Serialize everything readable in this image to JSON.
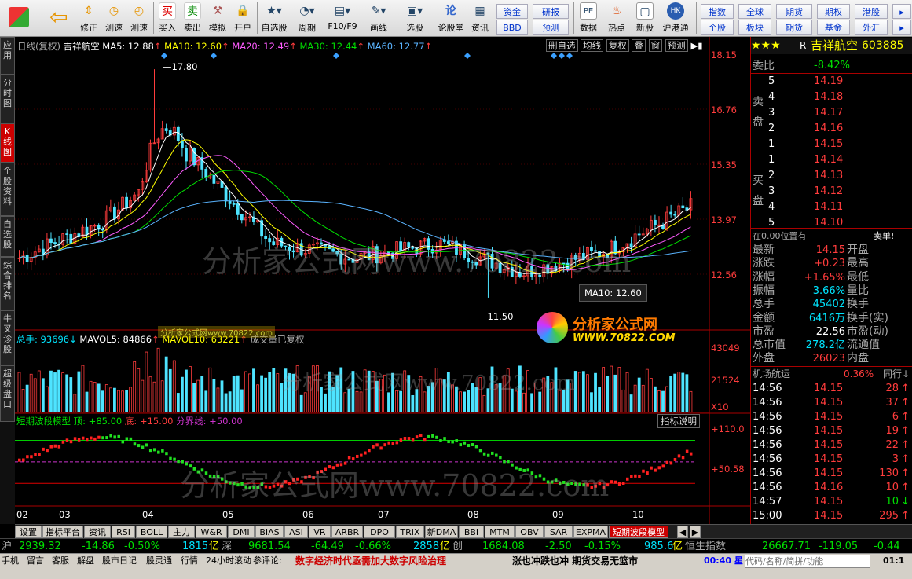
{
  "toolbar": {
    "buttons": [
      {
        "label": "",
        "icon": "windows-icon"
      },
      {
        "label": "",
        "icon": "back-arrow-icon"
      },
      {
        "label": "修正",
        "icon": "updown-icon"
      },
      {
        "label": "测速",
        "icon": "clock-icon"
      },
      {
        "label": "买入",
        "icon": "buy-icon"
      },
      {
        "label": "卖出",
        "icon": "sell-icon"
      },
      {
        "label": "模拟",
        "icon": "hammer-icon"
      },
      {
        "label": "开户",
        "icon": "lock-icon"
      },
      {
        "label": "自选股",
        "icon": "star-icon"
      },
      {
        "label": "周期",
        "icon": "cycle-icon"
      },
      {
        "label": "F10/F9",
        "icon": "f10-icon"
      },
      {
        "label": "画线",
        "icon": "pen-icon"
      },
      {
        "label": "选股",
        "icon": "select-stock-icon"
      },
      {
        "label": "论股堂",
        "icon": "forum-icon"
      },
      {
        "label": "资讯",
        "icon": "news-icon"
      },
      {
        "label": "数据",
        "icon": "data-icon"
      },
      {
        "label": "热点",
        "icon": "hot-icon"
      },
      {
        "label": "新股",
        "icon": "new-stock-icon"
      },
      {
        "label": "沪港通",
        "icon": "hk-connect-icon"
      }
    ],
    "mid_top": [
      "资金",
      "研报"
    ],
    "mid_bot": [
      "BBD",
      "预测"
    ],
    "right_top": [
      "指数",
      "全球",
      "期货",
      "期权",
      "港股"
    ],
    "right_bot": [
      "个股",
      "板块",
      "期货",
      "基金",
      "外汇"
    ]
  },
  "sidetabs": [
    "应用",
    "分时图",
    "K线图",
    "个股资料",
    "自选股",
    "综合排名",
    "牛叉诊股",
    "超级盘口"
  ],
  "chart": {
    "title_line": {
      "period": "日线(复权)",
      "name": "吉祥航空",
      "ma5": "MA5: 12.88",
      "ma10": "MA10: 12.60",
      "ma20": "MA20: 12.49",
      "ma30": "MA30: 12.44",
      "ma60": "MA60: 12.77"
    },
    "tools": [
      "删自选",
      "均线",
      "复权",
      "叠",
      "窗",
      "预测"
    ],
    "price_axis": [
      "18.15",
      "16.76",
      "15.35",
      "13.97",
      "12.56"
    ],
    "high_label": "17.80",
    "low_label": "11.50",
    "tooltip": "MA10: 12.60",
    "vol_title": {
      "total": "总手: 93696",
      "mavol5": "MAVOL5: 84866",
      "mavol10": "MAVOL10: 63221",
      "note": "成交量已复权"
    },
    "vol_axis": [
      "43049",
      "21524",
      "X10"
    ],
    "ind_title": {
      "name": "短期波段模型",
      "top": "顶: +85.00",
      "bottom": "底: +15.00",
      "line": "分界线: +50.00"
    },
    "ind_btn": "指标说明",
    "ind_axis": [
      "+110.0",
      "+50.58"
    ],
    "months": [
      "02",
      "03",
      "04",
      "05",
      "06",
      "07",
      "08",
      "09",
      "10"
    ],
    "watermark": "分析家公式网www.70822.com",
    "logo_text": "分析家公式网",
    "logo_url": "WWW.70822.COM"
  },
  "chart_data": {
    "type": "candlestick",
    "title": "吉祥航空",
    "ylim": [
      11.0,
      18.3
    ],
    "x": [
      "02",
      "03",
      "04",
      "05",
      "06",
      "07",
      "08",
      "09",
      "10"
    ],
    "close_trend": [
      12.6,
      13.6,
      15.5,
      13.0,
      12.6,
      13.0,
      12.2,
      12.8,
      14.0
    ],
    "high": 17.8,
    "low": 11.5,
    "ma": {
      "MA5": 12.88,
      "MA10": 12.6,
      "MA20": 12.49,
      "MA30": 12.44,
      "MA60": 12.77
    },
    "volume": {
      "total": 93696,
      "MAVOL5": 84866,
      "MAVOL10": 63221
    },
    "indicator": {
      "name": "短期波段模型",
      "top": 85.0,
      "bottom": 15.0,
      "line": 50.0
    }
  },
  "quote": {
    "stars": "★★★",
    "prefix": "R",
    "name": "吉祥航空",
    "code": "603885",
    "weibi_label": "委比",
    "weibi": "-8.42%",
    "sell_label": "卖盘",
    "buy_label": "买盘",
    "sell": [
      {
        "n": "5",
        "p": "14.19"
      },
      {
        "n": "4",
        "p": "14.18"
      },
      {
        "n": "3",
        "p": "14.17"
      },
      {
        "n": "2",
        "p": "14.16"
      },
      {
        "n": "1",
        "p": "14.15"
      }
    ],
    "buy": [
      {
        "n": "1",
        "p": "14.14"
      },
      {
        "n": "2",
        "p": "14.13"
      },
      {
        "n": "3",
        "p": "14.12"
      },
      {
        "n": "4",
        "p": "14.11"
      },
      {
        "n": "5",
        "p": "14.10"
      }
    ],
    "position": "在0.00位置有",
    "position_right": "卖单!",
    "stats": [
      {
        "k": "最新",
        "v": "14.15",
        "k2": "开盘",
        "c": "red"
      },
      {
        "k": "涨跌",
        "v": "+0.23",
        "k2": "最高",
        "c": "red"
      },
      {
        "k": "涨幅",
        "v": "+1.65%",
        "k2": "最低",
        "c": "red"
      },
      {
        "k": "振幅",
        "v": "3.66%",
        "k2": "量比",
        "c": "cyn"
      },
      {
        "k": "总手",
        "v": "45402",
        "k2": "换手",
        "c": "cyn"
      },
      {
        "k": "金额",
        "v": "6416万",
        "k2": "换手(实)",
        "c": "cyn"
      },
      {
        "k": "市盈",
        "v": "22.56",
        "k2": "市盈(动)",
        "c": "wht"
      },
      {
        "k": "总市值",
        "v": "278.2亿",
        "k2": "流通值",
        "c": "cyn"
      },
      {
        "k": "外盘",
        "v": "26023",
        "k2": "内盘",
        "c": "red"
      }
    ],
    "sector": "机场航运",
    "sector_pct": "0.36%",
    "sector_right": "同行↓",
    "trades": [
      {
        "t": "14:56",
        "p": "14.15",
        "v": "28",
        "d": "↑"
      },
      {
        "t": "14:56",
        "p": "14.15",
        "v": "37",
        "d": "↑"
      },
      {
        "t": "14:56",
        "p": "14.15",
        "v": "6",
        "d": "↑"
      },
      {
        "t": "14:56",
        "p": "14.15",
        "v": "19",
        "d": "↑"
      },
      {
        "t": "14:56",
        "p": "14.15",
        "v": "22",
        "d": "↑"
      },
      {
        "t": "14:56",
        "p": "14.15",
        "v": "3",
        "d": "↑"
      },
      {
        "t": "14:56",
        "p": "14.15",
        "v": "130",
        "d": "↑"
      },
      {
        "t": "14:56",
        "p": "14.16",
        "v": "10",
        "d": "↑"
      },
      {
        "t": "14:57",
        "p": "14.15",
        "v": "10",
        "d": "↓"
      },
      {
        "t": "15:00",
        "p": "14.15",
        "v": "295",
        "d": "↑"
      }
    ],
    "tabs": [
      "细",
      "分",
      "筹",
      "焰",
      "指",
      "财"
    ]
  },
  "bottom_tabs": [
    "设置",
    "指标平台",
    "资讯",
    "RSI",
    "BOLL",
    "主力",
    "W&R",
    "DMI",
    "BIAS",
    "ASI",
    "VR",
    "ARBR",
    "DPO",
    "TRIX",
    "新DMA",
    "BBI",
    "MTM",
    "OBV",
    "SAR",
    "EXPMA",
    "短期波段模型"
  ],
  "index_bar": {
    "sh": "沪",
    "sh_val": "2939.32",
    "sh_chg": "-14.86",
    "sh_pct": "-0.50%",
    "sh_amt": "1815",
    "sh_unit": "亿",
    "sz": "深",
    "sz_val": "9681.54",
    "sz_chg": "-64.49",
    "sz_pct": "-0.66%",
    "sz_amt": "2858",
    "sz_unit": "亿",
    "cy": "创",
    "cy_val": "1684.08",
    "cy_chg": "-2.50",
    "cy_pct": "-0.15%",
    "cy_amt": "985.6",
    "cy_unit": "亿",
    "hs": "恒生指数",
    "hs_val": "26667.71",
    "hs_chg": "-119.05",
    "hs_pct": "-0.44"
  },
  "status": {
    "items": [
      "手机",
      "留言",
      "客服",
      "解盘",
      "股市日记",
      "股灵通",
      "行情",
      "24小时滚动"
    ],
    "comment_label": "参评论:",
    "comment": "数字经济时代亟需加大数字风险治理",
    "ticker": "涨也冲跌也冲 期货交易无篮市",
    "time": "00:40 星",
    "search_placeholder": "代码/名称/简拼/功能",
    "clock": "01:1"
  }
}
